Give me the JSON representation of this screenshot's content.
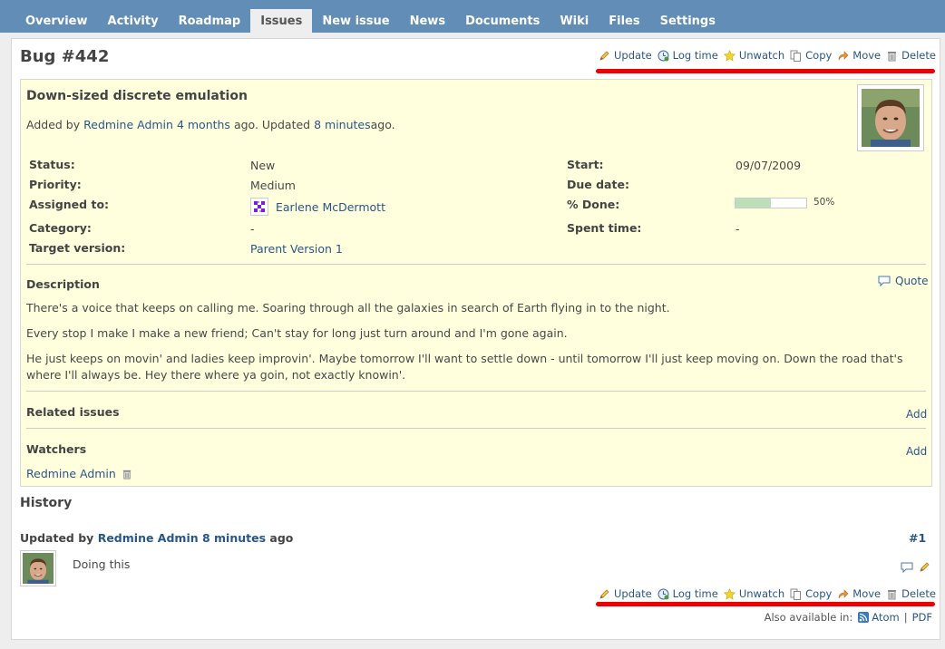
{
  "tabs": [
    {
      "label": "Overview"
    },
    {
      "label": "Activity"
    },
    {
      "label": "Roadmap"
    },
    {
      "label": "Issues",
      "selected": true
    },
    {
      "label": "New issue"
    },
    {
      "label": "News"
    },
    {
      "label": "Documents"
    },
    {
      "label": "Wiki"
    },
    {
      "label": "Files"
    },
    {
      "label": "Settings"
    }
  ],
  "issue": {
    "title": "Bug #442",
    "subject": "Down-sized discrete emulation",
    "author_prefix": "Added by",
    "author": "Redmine Admin",
    "added_ago": "4 months",
    "ago1": "ago. Updated",
    "updated_ago": "8 minutes",
    "ago2": "ago.",
    "attributes": {
      "status_label": "Status:",
      "status": "New",
      "priority_label": "Priority:",
      "priority": "Medium",
      "assigned_label": "Assigned to:",
      "assigned": "Earlene McDermott",
      "category_label": "Category:",
      "category": "-",
      "version_label": "Target version:",
      "version": "Parent Version 1",
      "start_label": "Start:",
      "start": "09/07/2009",
      "due_label": "Due date:",
      "due": "",
      "done_label": "% Done:",
      "done": "50%",
      "done_value": 50,
      "spent_label": "Spent time:",
      "spent": "-"
    },
    "description_title": "Description",
    "quote_label": "Quote",
    "description": [
      "There's a voice that keeps on calling me. Soaring through all the galaxies in search of Earth flying in to the night.",
      "Every stop I make I make a new friend; Can't stay for long just turn around and I'm gone again.",
      "He just keeps on movin' and ladies keep improvin'. Maybe tomorrow I'll want to settle down - until tomorrow I'll just keep moving on. Down the road that's where I'll always be. Hey there where ya goin, not exactly knowin'."
    ],
    "related_title": "Related issues",
    "related_add": "Add",
    "watchers_title": "Watchers",
    "watchers_add": "Add",
    "watcher": "Redmine Admin"
  },
  "actions": {
    "update": "Update",
    "log_time": "Log time",
    "unwatch": "Unwatch",
    "copy": "Copy",
    "move": "Move",
    "delete": "Delete"
  },
  "history": {
    "title": "History",
    "updated_by": "Updated by",
    "user": "Redmine Admin",
    "ago_time": "8 minutes",
    "ago": "ago",
    "number": "#1",
    "note": "Doing this"
  },
  "footer": {
    "also": "Also available in:",
    "atom": "Atom",
    "sep": "|",
    "pdf": "PDF"
  },
  "colors": {
    "tabbar": "#628db6",
    "highlight": "#ee0000",
    "issue_bg": "#ffffdd"
  }
}
